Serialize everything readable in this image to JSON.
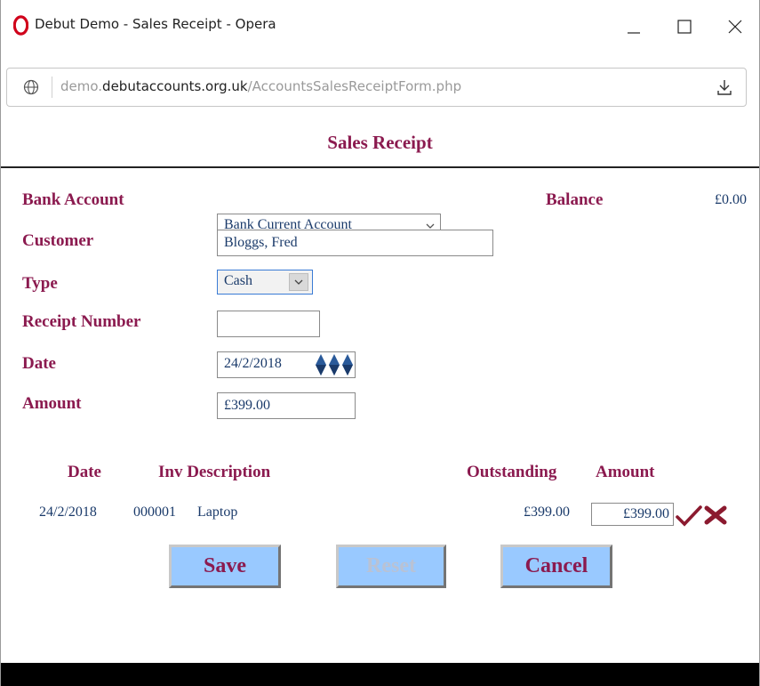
{
  "window": {
    "title": "Debut Demo - Sales Receipt - Opera",
    "url_prefix": "demo.",
    "url_domain": "debutaccounts.org.uk",
    "url_path": "/AccountsSalesReceiptForm.php"
  },
  "page": {
    "title": "Sales Receipt"
  },
  "form": {
    "bank_account_label": "Bank Account",
    "bank_account_value": "Bank Current Account",
    "balance_label": "Balance",
    "balance_value": "£0.00",
    "customer_label": "Customer",
    "customer_value": "Bloggs, Fred",
    "type_label": "Type",
    "type_value": "Cash",
    "receipt_number_label": "Receipt Number",
    "receipt_number_value": "",
    "date_label": "Date",
    "date_value": "24/2/2018",
    "amount_label": "Amount",
    "amount_value": "£399.00"
  },
  "table": {
    "headers": {
      "date": "Date",
      "inv_description": "Inv Description",
      "outstanding": "Outstanding",
      "amount": "Amount"
    },
    "rows": [
      {
        "date": "24/2/2018",
        "inv": "000001",
        "description": "Laptop",
        "outstanding": "£399.00",
        "amount": "£399.00"
      }
    ]
  },
  "buttons": {
    "save": "Save",
    "reset": "Reset",
    "cancel": "Cancel"
  },
  "colors": {
    "label": "#8b1a4f",
    "value": "#1a3a6a",
    "button_bg": "#99c9ff"
  },
  "icons": {
    "opera": "opera-logo-icon",
    "minimize": "minimize-icon",
    "maximize": "maximize-icon",
    "close": "close-icon",
    "globe": "globe-icon",
    "download": "download-icon",
    "date_picker": "date-spinner-icon",
    "confirm": "checkmark-icon",
    "delete": "cross-icon"
  }
}
